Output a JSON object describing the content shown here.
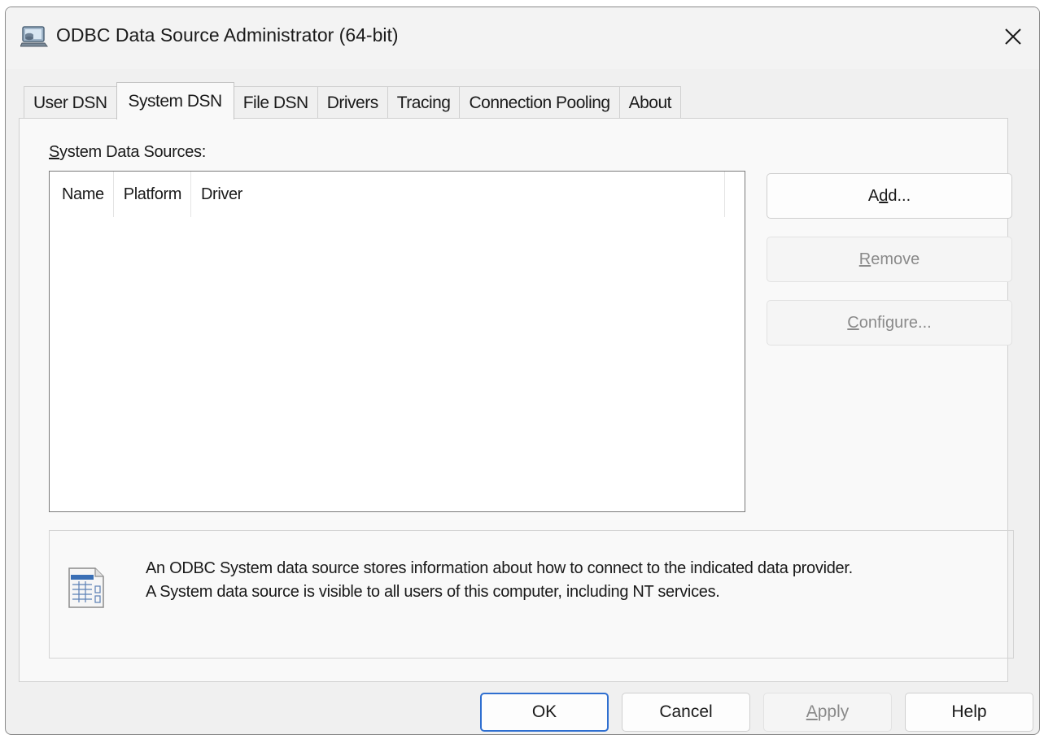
{
  "window": {
    "title": "ODBC Data Source Administrator (64-bit)",
    "app_icon": "odbc-admin-icon",
    "close_icon": "close-icon"
  },
  "tabs": [
    {
      "label": "User DSN",
      "active": false
    },
    {
      "label": "System DSN",
      "active": true
    },
    {
      "label": "File DSN",
      "active": false
    },
    {
      "label": "Drivers",
      "active": false
    },
    {
      "label": "Tracing",
      "active": false
    },
    {
      "label": "Connection Pooling",
      "active": false
    },
    {
      "label": "About",
      "active": false
    }
  ],
  "panel": {
    "sources_label_pre": "",
    "sources_label_ul": "S",
    "sources_label_post": "ystem Data Sources:",
    "columns": [
      "Name",
      "Platform",
      "Driver"
    ],
    "rows": []
  },
  "side_buttons": {
    "add": {
      "pre": "A",
      "ul": "d",
      "post": "d...",
      "enabled": true
    },
    "remove": {
      "pre": "",
      "ul": "R",
      "post": "emove",
      "enabled": false
    },
    "configure": {
      "pre": "",
      "ul": "C",
      "post": "onfigure...",
      "enabled": false
    }
  },
  "info": {
    "icon": "data-source-icon",
    "line1": "An ODBC System data source stores information about how to connect to the indicated data provider.",
    "line2": "A System data source is visible to all users of this computer, including NT services."
  },
  "footer": {
    "ok": "OK",
    "cancel": "Cancel",
    "apply_ul": "A",
    "apply_rest": "pply",
    "help": "Help"
  },
  "colors": {
    "window_bg": "#f0f0f0",
    "panel_bg": "#f9f9f9",
    "accent": "#2f6fd0",
    "disabled_text": "#8a8a8a"
  }
}
